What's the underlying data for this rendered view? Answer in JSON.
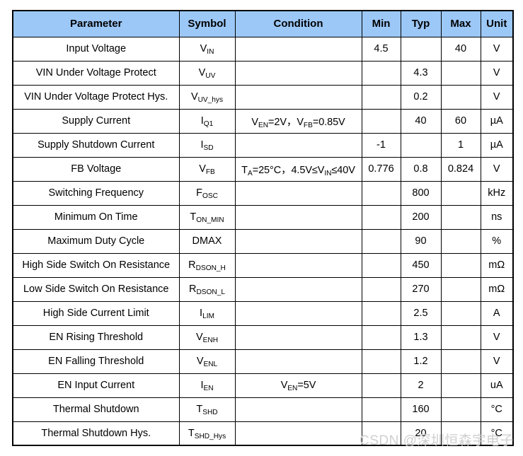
{
  "table": {
    "headers": [
      "Parameter",
      "Symbol",
      "Condition",
      "Min",
      "Typ",
      "Max",
      "Unit"
    ],
    "rows": [
      {
        "parameter": "Input Voltage",
        "symbol_base": "V",
        "symbol_sub": "IN",
        "condition_html": "",
        "min": "4.5",
        "typ": "",
        "max": "40",
        "unit": "V"
      },
      {
        "parameter": "VIN Under Voltage Protect",
        "symbol_base": "V",
        "symbol_sub": "UV",
        "condition_html": "",
        "min": "",
        "typ": "4.3",
        "max": "",
        "unit": "V"
      },
      {
        "parameter": "VIN Under Voltage Protect Hys.",
        "symbol_base": "V",
        "symbol_sub": "UV_hys",
        "condition_html": "",
        "min": "",
        "typ": "0.2",
        "max": "",
        "unit": "V"
      },
      {
        "parameter": "Supply Current",
        "symbol_base": "I",
        "symbol_sub": "Q1",
        "condition_html": "V<sub>EN</sub>=2V，V<sub>FB</sub>=0.85V",
        "min": "",
        "typ": "40",
        "max": "60",
        "unit": "µA"
      },
      {
        "parameter": "Supply Shutdown Current",
        "symbol_base": "I",
        "symbol_sub": "SD",
        "condition_html": "",
        "min": "-1",
        "typ": "",
        "max": "1",
        "unit": "µA"
      },
      {
        "parameter": "FB Voltage",
        "symbol_base": "V",
        "symbol_sub": "FB",
        "condition_html": "T<sub>A</sub>=25°C，4.5V≤V<sub>IN</sub>≤40V",
        "min": "0.776",
        "typ": "0.8",
        "max": "0.824",
        "unit": "V"
      },
      {
        "parameter": "Switching Frequency",
        "symbol_base": "F",
        "symbol_sub": "OSC",
        "condition_html": "",
        "min": "",
        "typ": "800",
        "max": "",
        "unit": "kHz"
      },
      {
        "parameter": "Minimum On Time",
        "symbol_base": "T",
        "symbol_sub": "ON_MIN",
        "condition_html": "",
        "min": "",
        "typ": "200",
        "max": "",
        "unit": "ns"
      },
      {
        "parameter": "Maximum Duty Cycle",
        "symbol_base": "DMAX",
        "symbol_sub": "",
        "condition_html": "",
        "min": "",
        "typ": "90",
        "max": "",
        "unit": "%"
      },
      {
        "parameter": "High Side Switch On Resistance",
        "symbol_base": "R",
        "symbol_sub": "DSON_H",
        "condition_html": "",
        "min": "",
        "typ": "450",
        "max": "",
        "unit": "mΩ"
      },
      {
        "parameter": "Low Side Switch On Resistance",
        "symbol_base": "R",
        "symbol_sub": "DSON_L",
        "condition_html": "",
        "min": "",
        "typ": "270",
        "max": "",
        "unit": "mΩ"
      },
      {
        "parameter": "High Side Current Limit",
        "symbol_base": "I",
        "symbol_sub": "LIM",
        "condition_html": "",
        "min": "",
        "typ": "2.5",
        "max": "",
        "unit": "A"
      },
      {
        "parameter": "EN Rising Threshold",
        "symbol_base": "V",
        "symbol_sub": "ENH",
        "condition_html": "",
        "min": "",
        "typ": "1.3",
        "max": "",
        "unit": "V"
      },
      {
        "parameter": "EN Falling Threshold",
        "symbol_base": "V",
        "symbol_sub": "ENL",
        "condition_html": "",
        "min": "",
        "typ": "1.2",
        "max": "",
        "unit": "V"
      },
      {
        "parameter": "EN Input Current",
        "symbol_base": "I",
        "symbol_sub": "EN",
        "condition_html": "V<sub>EN</sub>=5V",
        "min": "",
        "typ": "2",
        "max": "",
        "unit": "uA"
      },
      {
        "parameter": "Thermal Shutdown",
        "symbol_base": "T",
        "symbol_sub": "SHD",
        "condition_html": "",
        "min": "",
        "typ": "160",
        "max": "",
        "unit": "°C"
      },
      {
        "parameter": "Thermal Shutdown Hys.",
        "symbol_base": "T",
        "symbol_sub": "SHD_Hys",
        "condition_html": "",
        "min": "",
        "typ": "20",
        "max": "",
        "unit": "°C"
      }
    ]
  },
  "watermark": {
    "text": "CSDN @深圳恒森宇电子"
  },
  "colors": {
    "header_bg": "#9CC8F7",
    "border": "#000000",
    "text": "#000000",
    "watermark": "#cfcfcf"
  }
}
